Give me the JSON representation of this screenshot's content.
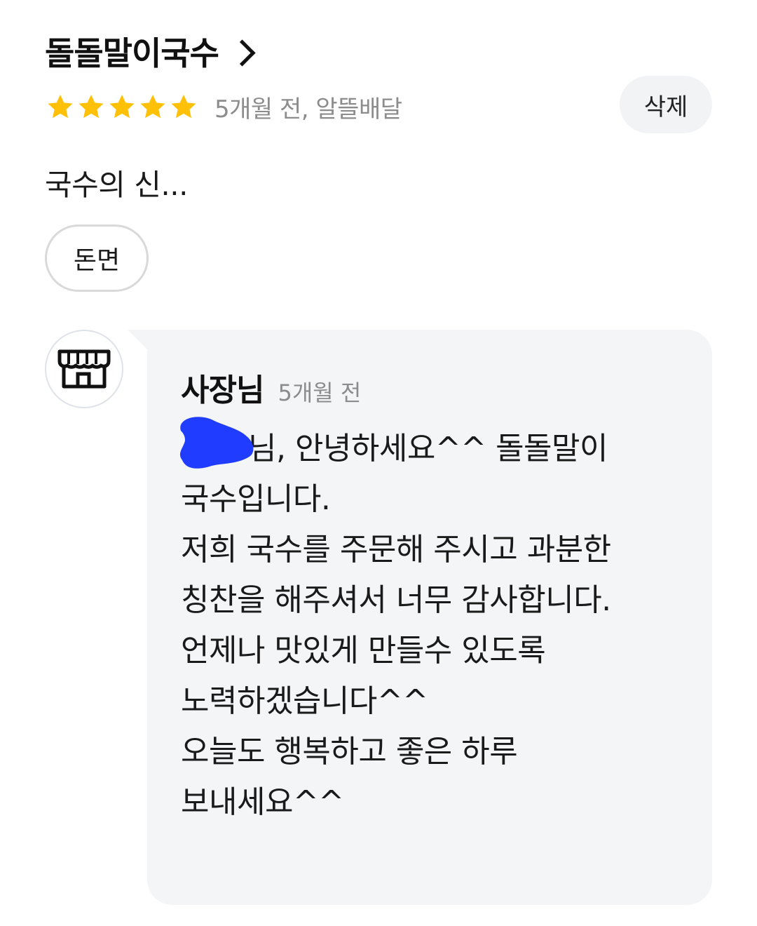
{
  "review": {
    "store_name": "돌돌말이국수",
    "rating": 5,
    "rating_max": 5,
    "meta": "5개월 전, 알뜰배달",
    "delete_label": "삭제",
    "text": "국수의 신...",
    "menu_tag": "돈면"
  },
  "reply": {
    "author": "사장님",
    "time": "5개월 전",
    "lines": [
      "님, 안녕하세요^^ 돌돌말이",
      "국수입니다.",
      "저희 국수를 주문해 주시고 과분한",
      "칭찬을 해주셔서 너무 감사합니다.",
      "언제나 맛있게 만들수 있도록",
      "노력하겠습니다^^",
      "오늘도 행복하고 좋은 하루",
      "보내세요^^"
    ]
  },
  "colors": {
    "star": "#ffc107",
    "meta_text": "#8c8c8c",
    "chip_bg": "#f2f3f5",
    "bubble_bg": "#f4f5f7",
    "redaction": "#1f3cff"
  },
  "icons": {
    "header_chevron": "chevron-right-icon",
    "star": "star-icon",
    "owner_avatar": "storefront-icon"
  }
}
